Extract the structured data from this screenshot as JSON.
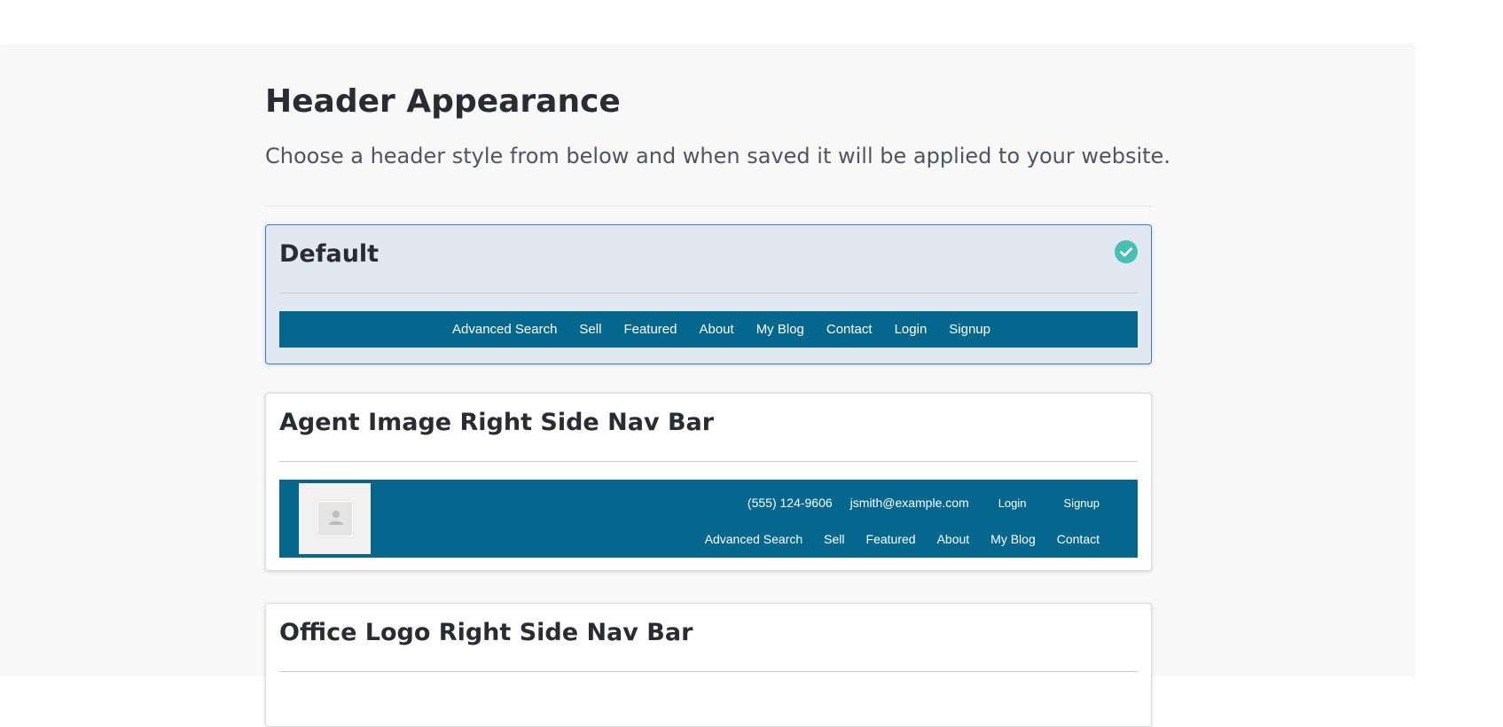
{
  "page": {
    "title": "Header Appearance",
    "subtitle": "Choose a header style from below and when saved it will be applied to your website."
  },
  "options": [
    {
      "title": "Default",
      "selected": true,
      "icon": "check-circle-icon",
      "nav": [
        "Advanced Search",
        "Sell",
        "Featured",
        "About",
        "My Blog",
        "Contact",
        "Login",
        "Signup"
      ]
    },
    {
      "title": "Agent Image Right Side Nav Bar",
      "selected": false,
      "phone": "(555) 124-9606",
      "email": "jsmith@example.com",
      "top_links": [
        "Login",
        "Signup"
      ],
      "nav": [
        "Advanced Search",
        "Sell",
        "Featured",
        "About",
        "My Blog",
        "Contact"
      ],
      "photo_icon": "person-placeholder-icon"
    },
    {
      "title": "Office Logo Right Side Nav Bar",
      "selected": false
    }
  ],
  "colors": {
    "nav_background": "#05678d",
    "selected_background": "#e1e8f1",
    "selected_border": "#3a7ec3",
    "check": "#46c0b5",
    "panel_background": "#f8f8f8"
  }
}
